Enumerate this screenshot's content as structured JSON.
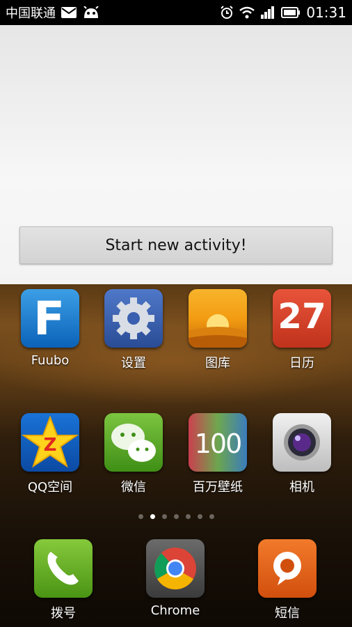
{
  "status_bar": {
    "carrier": "中国联通",
    "time": "01:31"
  },
  "activity": {
    "start_button": "Start new activity!"
  },
  "home": {
    "row1": [
      {
        "label": "Fuubo",
        "icon": "fuubo-icon"
      },
      {
        "label": "设置",
        "icon": "settings-gear-icon"
      },
      {
        "label": "图库",
        "icon": "gallery-sunset-icon"
      },
      {
        "label": "日历",
        "icon": "calendar-icon",
        "badge": "27"
      }
    ],
    "row2": [
      {
        "label": "QQ空间",
        "icon": "qzone-star-icon"
      },
      {
        "label": "微信",
        "icon": "wechat-bubbles-icon"
      },
      {
        "label": "百万壁纸",
        "icon": "wallpaper-icon",
        "badge": "100"
      },
      {
        "label": "相机",
        "icon": "camera-icon"
      }
    ],
    "dock": [
      {
        "label": "拨号",
        "icon": "phone-icon"
      },
      {
        "label": "Chrome",
        "icon": "chrome-icon"
      },
      {
        "label": "短信",
        "icon": "sms-icon"
      }
    ],
    "page_indicator": {
      "total": 7,
      "active_index": 1
    }
  }
}
